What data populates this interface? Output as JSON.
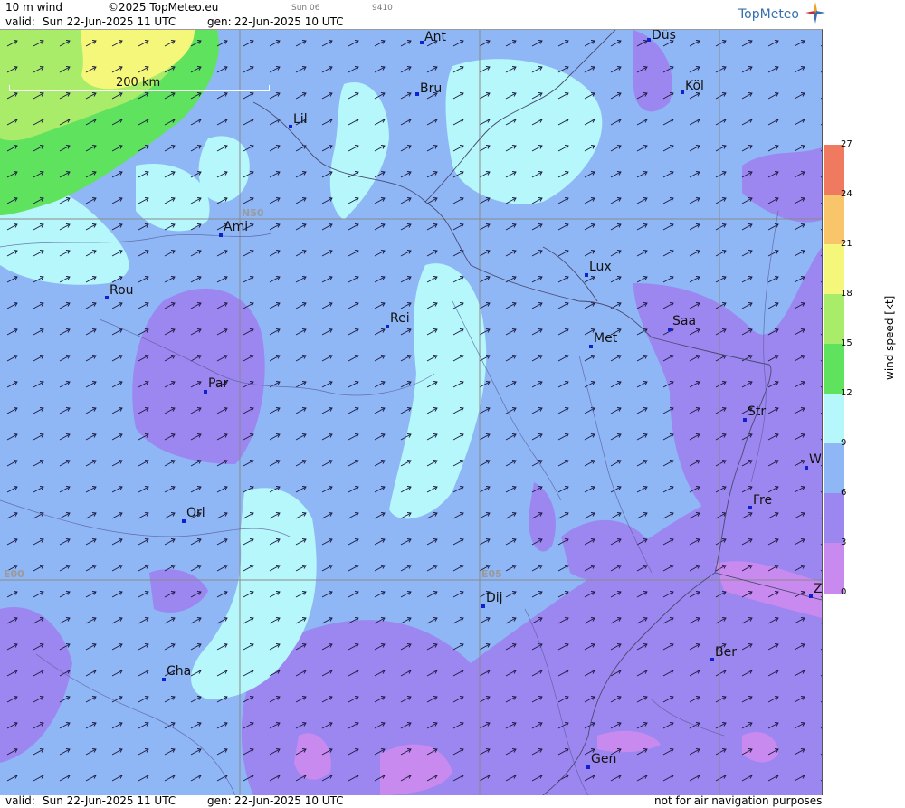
{
  "header": {
    "product": "10 m wind",
    "copyright": "©2025 TopMeteo.eu",
    "valid_label": "valid:",
    "valid_time": "Sun  22-Jun-2025  11 UTC",
    "gen_label": "gen:",
    "gen_time": "22-Jun-2025 10 UTC",
    "small_1": "Sun 06",
    "small_2": "9410",
    "logo": "TopMeteo"
  },
  "footer": {
    "valid_label": "valid:",
    "valid_time": "Sun  22-Jun-2025  11 UTC",
    "gen_label": "gen:",
    "gen_time": "22-Jun-2025 10 UTC",
    "disclaimer": "not for air navigation purposes"
  },
  "map": {
    "scale_label": "200 km",
    "grid_labels": {
      "lat": "N50",
      "lon0": "E00",
      "lon5": "E05"
    },
    "cities": [
      {
        "id": "ant",
        "name": "Ant"
      },
      {
        "id": "dus",
        "name": "Düs"
      },
      {
        "id": "bru",
        "name": "Bru"
      },
      {
        "id": "kol",
        "name": "Köl"
      },
      {
        "id": "lil",
        "name": "Lil"
      },
      {
        "id": "ami",
        "name": "Ami"
      },
      {
        "id": "lux",
        "name": "Lux"
      },
      {
        "id": "rou",
        "name": "Rou"
      },
      {
        "id": "rei",
        "name": "Rei"
      },
      {
        "id": "saa",
        "name": "Saa"
      },
      {
        "id": "met",
        "name": "Met"
      },
      {
        "id": "par",
        "name": "Par"
      },
      {
        "id": "str",
        "name": "Str"
      },
      {
        "id": "w",
        "name": "W"
      },
      {
        "id": "fre",
        "name": "Fre"
      },
      {
        "id": "orl",
        "name": "Orl"
      },
      {
        "id": "dij",
        "name": "Dij"
      },
      {
        "id": "ber",
        "name": "Ber"
      },
      {
        "id": "cha",
        "name": "Cha"
      },
      {
        "id": "gen",
        "name": "Gen"
      },
      {
        "id": "edge",
        "name": "Z"
      }
    ]
  },
  "legend": {
    "title": "wind speed [kt]",
    "ticks": [
      "27",
      "24",
      "21",
      "18",
      "15",
      "12",
      "9",
      "6",
      "3",
      "0"
    ],
    "colors": {
      "0_3": "#c98af0",
      "3_6": "#9c86f0",
      "6_9": "#8fb6f5",
      "9_12": "#b5f7fb",
      "12_15": "#5fe35f",
      "15_18": "#a9ec6a",
      "18_21": "#f4f77a",
      "21_24": "#f9c56a",
      "24_27": "#f07a5f"
    }
  }
}
